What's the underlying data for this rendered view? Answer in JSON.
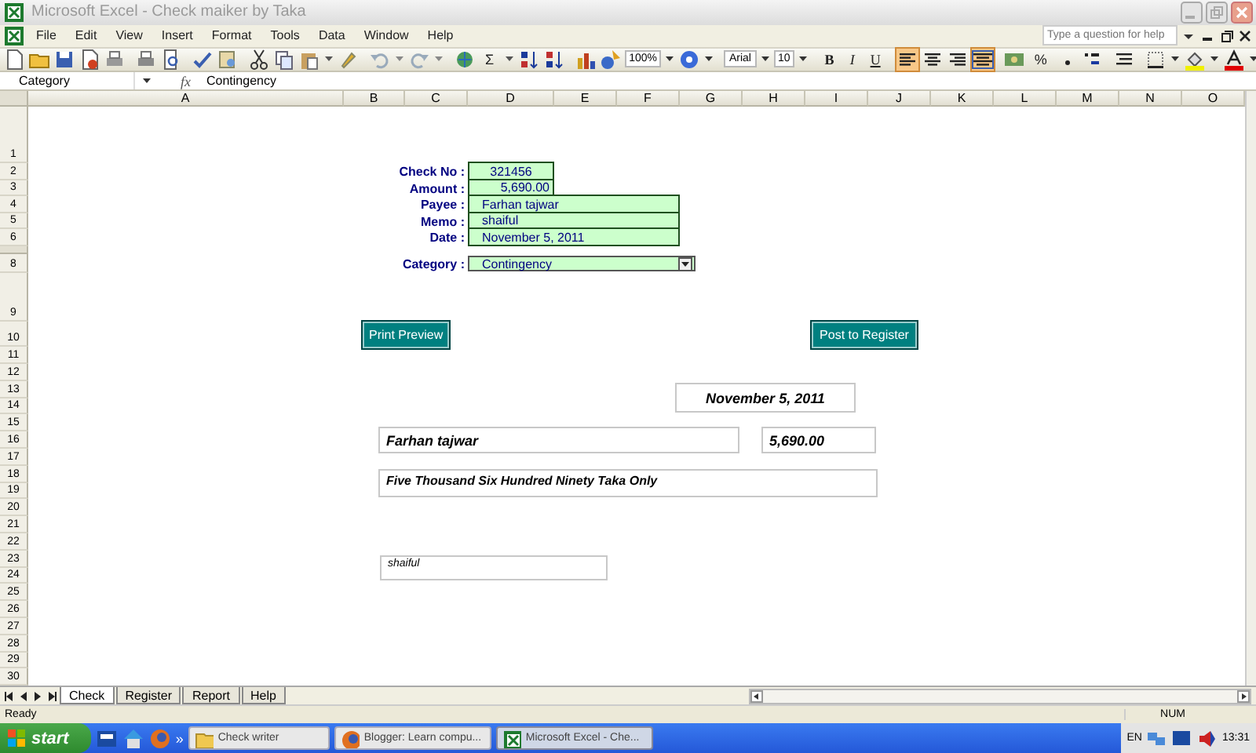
{
  "window": {
    "title": "Microsoft Excel - Check maiker by Taka"
  },
  "menu": {
    "items": [
      "File",
      "Edit",
      "View",
      "Insert",
      "Format",
      "Tools",
      "Data",
      "Window",
      "Help"
    ],
    "help_placeholder": "Type a question for help"
  },
  "toolbar": {
    "autosum": "Σ",
    "zoom": "100%",
    "font": "Arial",
    "size": "10",
    "format_buttons": [
      "B",
      "I",
      "U"
    ],
    "alignment_buttons": [
      {
        "selected": true
      },
      {
        "selected": false
      },
      {
        "selected": false
      },
      {
        "selected": true
      }
    ],
    "percent": "%"
  },
  "formula_bar": {
    "name_box": "Category",
    "fx": "fx",
    "value": "Contingency"
  },
  "sheet": {
    "columns": [
      "A",
      "B",
      "C",
      "D",
      "E",
      "F",
      "G",
      "H",
      "I",
      "J",
      "K",
      "L",
      "M",
      "N",
      "O"
    ],
    "rows": [
      "1",
      "2",
      "3",
      "4",
      "5",
      "6",
      "8",
      "9",
      "10",
      "11",
      "12",
      "13",
      "14",
      "15",
      "16",
      "17",
      "18",
      "19",
      "20",
      "21",
      "22",
      "23",
      "24",
      "25",
      "26",
      "27",
      "28",
      "29",
      "30"
    ],
    "form": [
      {
        "label": "Check No :",
        "value": "321456",
        "kind": "short"
      },
      {
        "label": "Amount :",
        "value": "5,690.00",
        "kind": "amount"
      },
      {
        "label": "Payee :",
        "value": "Farhan tajwar",
        "kind": "wide"
      },
      {
        "label": "Memo :",
        "value": "shaiful",
        "kind": "wide"
      },
      {
        "label": "Date :",
        "value": "November 5, 2011",
        "kind": "wide"
      }
    ],
    "category": {
      "label": "Category :",
      "value": "Contingency"
    },
    "buttons": [
      "Print Preview",
      "Post to Register"
    ],
    "check": {
      "date": "November 5, 2011",
      "payee": "Farhan tajwar",
      "amount": "5,690.00",
      "amount_words": "Five Thousand Six Hundred Ninety Taka Only",
      "memo": "shaiful"
    }
  },
  "sheet_tabs": [
    {
      "label": "Check",
      "selected": true
    },
    {
      "label": "Register",
      "selected": false
    },
    {
      "label": "Report",
      "selected": false
    },
    {
      "label": "Help",
      "selected": false
    }
  ],
  "status_bar": {
    "left": "Ready",
    "right": "NUM"
  },
  "taskbar": {
    "start": "start",
    "more": "»",
    "tasks": [
      {
        "label": "Check writer",
        "selected": false
      },
      {
        "label": "Blogger: Learn compu...",
        "selected": false
      },
      {
        "label": "Microsoft Excel - Che...",
        "selected": true
      }
    ],
    "language": "EN",
    "clock": "13:31"
  }
}
